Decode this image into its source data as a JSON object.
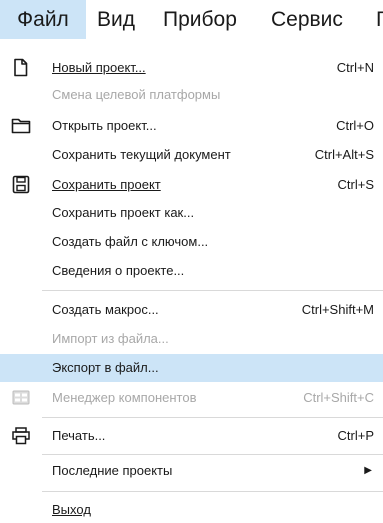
{
  "menubar": {
    "items": [
      "Файл",
      "Вид",
      "Прибор",
      "Сервис",
      "Г"
    ]
  },
  "file_menu": {
    "new_project": {
      "label": "Новый проект...",
      "shortcut": "Ctrl+N"
    },
    "change_platform": {
      "label": "Смена целевой платформы"
    },
    "open_project": {
      "label": "Открыть проект...",
      "shortcut": "Ctrl+O"
    },
    "save_document": {
      "label": "Сохранить текущий документ",
      "shortcut": "Ctrl+Alt+S"
    },
    "save_project": {
      "label": "Сохранить проект",
      "shortcut": "Ctrl+S"
    },
    "save_project_as": {
      "label": "Сохранить проект как..."
    },
    "create_key_file": {
      "label": "Создать файл с ключом..."
    },
    "project_info": {
      "label": "Сведения о проекте..."
    },
    "create_macro": {
      "label": "Создать макрос...",
      "shortcut": "Ctrl+Shift+M"
    },
    "import_file": {
      "label": "Импорт из файла..."
    },
    "export_file": {
      "label": "Экспорт в файл..."
    },
    "component_manager": {
      "label": "Менеджер компонентов",
      "shortcut": "Ctrl+Shift+C"
    },
    "print": {
      "label": "Печать...",
      "shortcut": "Ctrl+P"
    },
    "recent_projects": {
      "label": "Последние проекты"
    },
    "exit": {
      "label": "Выход"
    }
  },
  "icons": {
    "new_project": "new-document-icon",
    "open_project": "folder-icon",
    "save_project": "floppy-disk-icon",
    "component_manager": "component-manager-icon",
    "print": "printer-icon",
    "recent_projects": "submenu-arrow-icon"
  },
  "colors": {
    "highlight": "#cce4f7",
    "text": "#1a1a1a",
    "disabled_text": "#a8a8a8",
    "separator": "#d9d9d9"
  }
}
